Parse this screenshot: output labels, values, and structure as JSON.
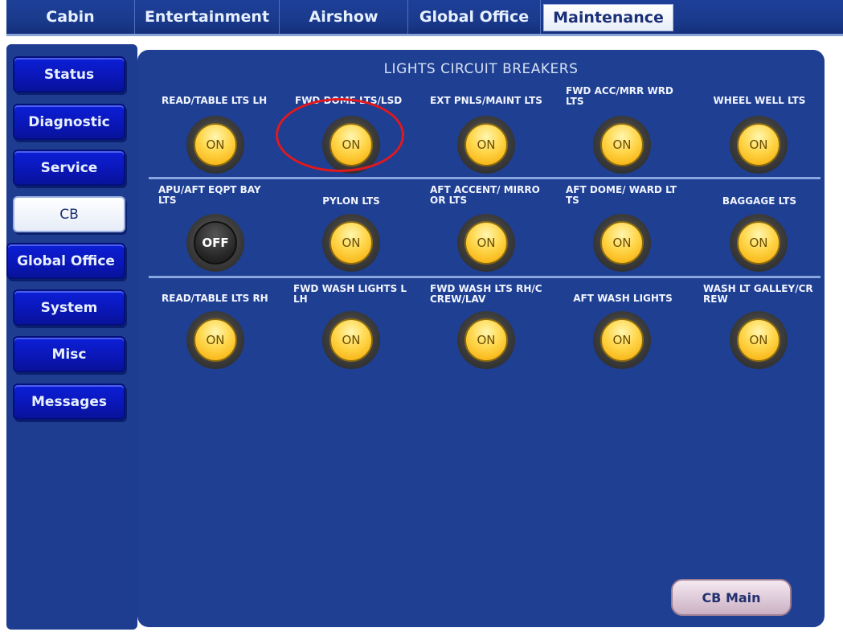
{
  "top_tabs": [
    {
      "label": "Cabin"
    },
    {
      "label": "Entertainment"
    },
    {
      "label": "Airshow"
    },
    {
      "label": "Global Office"
    },
    {
      "label": "Maintenance",
      "active": true
    }
  ],
  "sidebar": {
    "items": [
      {
        "label": "Status"
      },
      {
        "label": "Diagnostic"
      },
      {
        "label": "Service"
      },
      {
        "label": "CB",
        "active": true
      },
      {
        "label": "Global Office"
      },
      {
        "label": "System"
      },
      {
        "label": "Misc"
      },
      {
        "label": "Messages"
      }
    ]
  },
  "panel": {
    "title": "LIGHTS CIRCUIT BREAKERS",
    "breakers": [
      {
        "label": "READ/TABLE LTS LH",
        "state": "ON"
      },
      {
        "label": "FWD DOME LTS/LSD",
        "state": "ON"
      },
      {
        "label": "EXT PNLS/MAINT LTS",
        "state": "ON"
      },
      {
        "label": "FWD ACC/MRR WRD LTS",
        "state": "ON"
      },
      {
        "label": "WHEEL WELL LTS",
        "state": "ON"
      },
      {
        "label": "APU/AFT EQPT BAY LTS",
        "state": "OFF"
      },
      {
        "label": "PYLON LTS",
        "state": "ON"
      },
      {
        "label": "AFT ACCENT/ MIRRO OR LTS",
        "state": "ON"
      },
      {
        "label": "AFT DOME/ WARD LT TS",
        "state": "ON"
      },
      {
        "label": "BAGGAGE LTS",
        "state": "ON"
      },
      {
        "label": "READ/TABLE LTS RH",
        "state": "ON"
      },
      {
        "label": "FWD WASH LIGHTS L LH",
        "state": "ON"
      },
      {
        "label": "FWD WASH LTS RH/C CREW/LAV",
        "state": "ON"
      },
      {
        "label": "AFT WASH LIGHTS",
        "state": "ON"
      },
      {
        "label": "WASH LT GALLEY/CR REW",
        "state": "ON"
      }
    ],
    "cb_main_label": "CB Main"
  },
  "colors": {
    "nav_blue": "#0c1fd8",
    "panel_blue": "#1e3f92",
    "breaker_on": "#ffd64a",
    "breaker_off": "#2a2a2a",
    "highlight": "#e0191f"
  }
}
